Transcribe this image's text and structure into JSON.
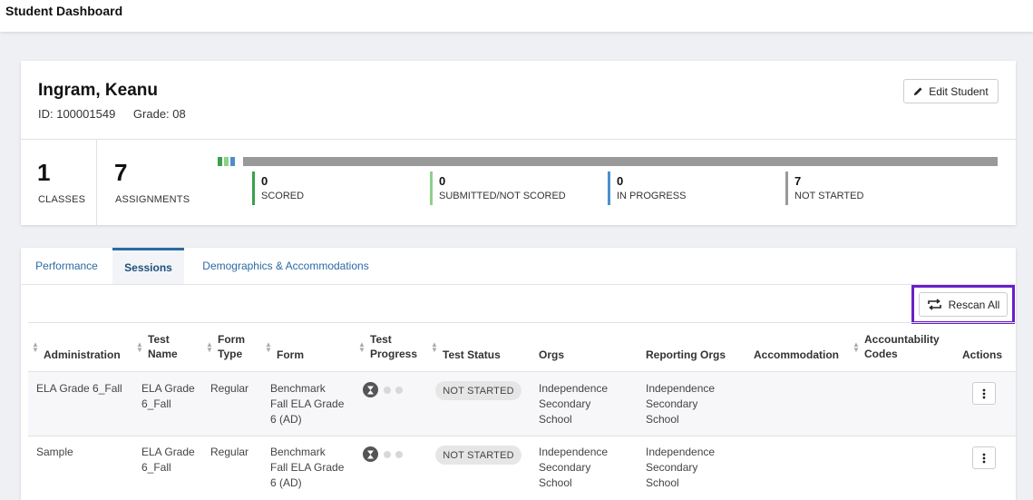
{
  "header": {
    "title": "Student Dashboard"
  },
  "student": {
    "name": "Ingram, Keanu",
    "id_text": "ID: 100001549",
    "grade_text": "Grade: 08",
    "edit_label": "Edit Student"
  },
  "stats": {
    "classes": {
      "value": "1",
      "label": "CLASSES"
    },
    "assignments": {
      "value": "7",
      "label": "ASSIGNMENTS"
    }
  },
  "progress": {
    "total": 7,
    "segments": [
      {
        "key": "scored",
        "count": 0,
        "color": "#3aa14d"
      },
      {
        "key": "submitted",
        "count": 0,
        "color": "#8fd08a"
      },
      {
        "key": "in_progress",
        "count": 0,
        "color": "#4b8fcc"
      },
      {
        "key": "not_started",
        "count": 7,
        "color": "#999999"
      }
    ],
    "legend": [
      {
        "value": "0",
        "label": "SCORED",
        "color": "#3aa14d"
      },
      {
        "value": "0",
        "label": "SUBMITTED/NOT SCORED",
        "color": "#8fd08a"
      },
      {
        "value": "0",
        "label": "IN PROGRESS",
        "color": "#4b8fcc"
      },
      {
        "value": "7",
        "label": "NOT STARTED",
        "color": "#999999"
      }
    ]
  },
  "tabs": [
    {
      "label": "Performance",
      "active": false
    },
    {
      "label": "Sessions",
      "active": true
    },
    {
      "label": "Demographics & Accommodations",
      "active": false
    }
  ],
  "toolbar": {
    "rescan_label": "Rescan All"
  },
  "table": {
    "headers": {
      "administration": "Administration",
      "test_name_1": "Test",
      "test_name_2": "Name",
      "form_type_1": "Form",
      "form_type_2": "Type",
      "form": "Form",
      "test_progress_1": "Test",
      "test_progress_2": "Progress",
      "test_status": "Test Status",
      "orgs": "Orgs",
      "reporting_orgs": "Reporting Orgs",
      "accommodation": "Accommodation",
      "accountability_1": "Accountability",
      "accountability_2": "Codes",
      "actions": "Actions"
    },
    "rows": [
      {
        "administration": "ELA Grade 6_Fall",
        "test_name_1": "ELA Grade",
        "test_name_2": "6_Fall",
        "form_type": "Regular",
        "form_1": "Benchmark",
        "form_2": "Fall ELA Grade",
        "form_3": "6 (AD)",
        "status": "NOT STARTED",
        "orgs_1": "Independence",
        "orgs_2": "Secondary",
        "orgs_3": "School",
        "rorgs_1": "Independence",
        "rorgs_2": "Secondary",
        "rorgs_3": "School"
      },
      {
        "administration": "Sample",
        "test_name_1": "ELA Grade",
        "test_name_2": "6_Fall",
        "form_type": "Regular",
        "form_1": "Benchmark",
        "form_2": "Fall ELA Grade",
        "form_3": "6 (AD)",
        "status": "NOT STARTED",
        "orgs_1": "Independence",
        "orgs_2": "Secondary",
        "orgs_3": "School",
        "rorgs_1": "Independence",
        "rorgs_2": "Secondary",
        "rorgs_3": "School"
      }
    ]
  }
}
